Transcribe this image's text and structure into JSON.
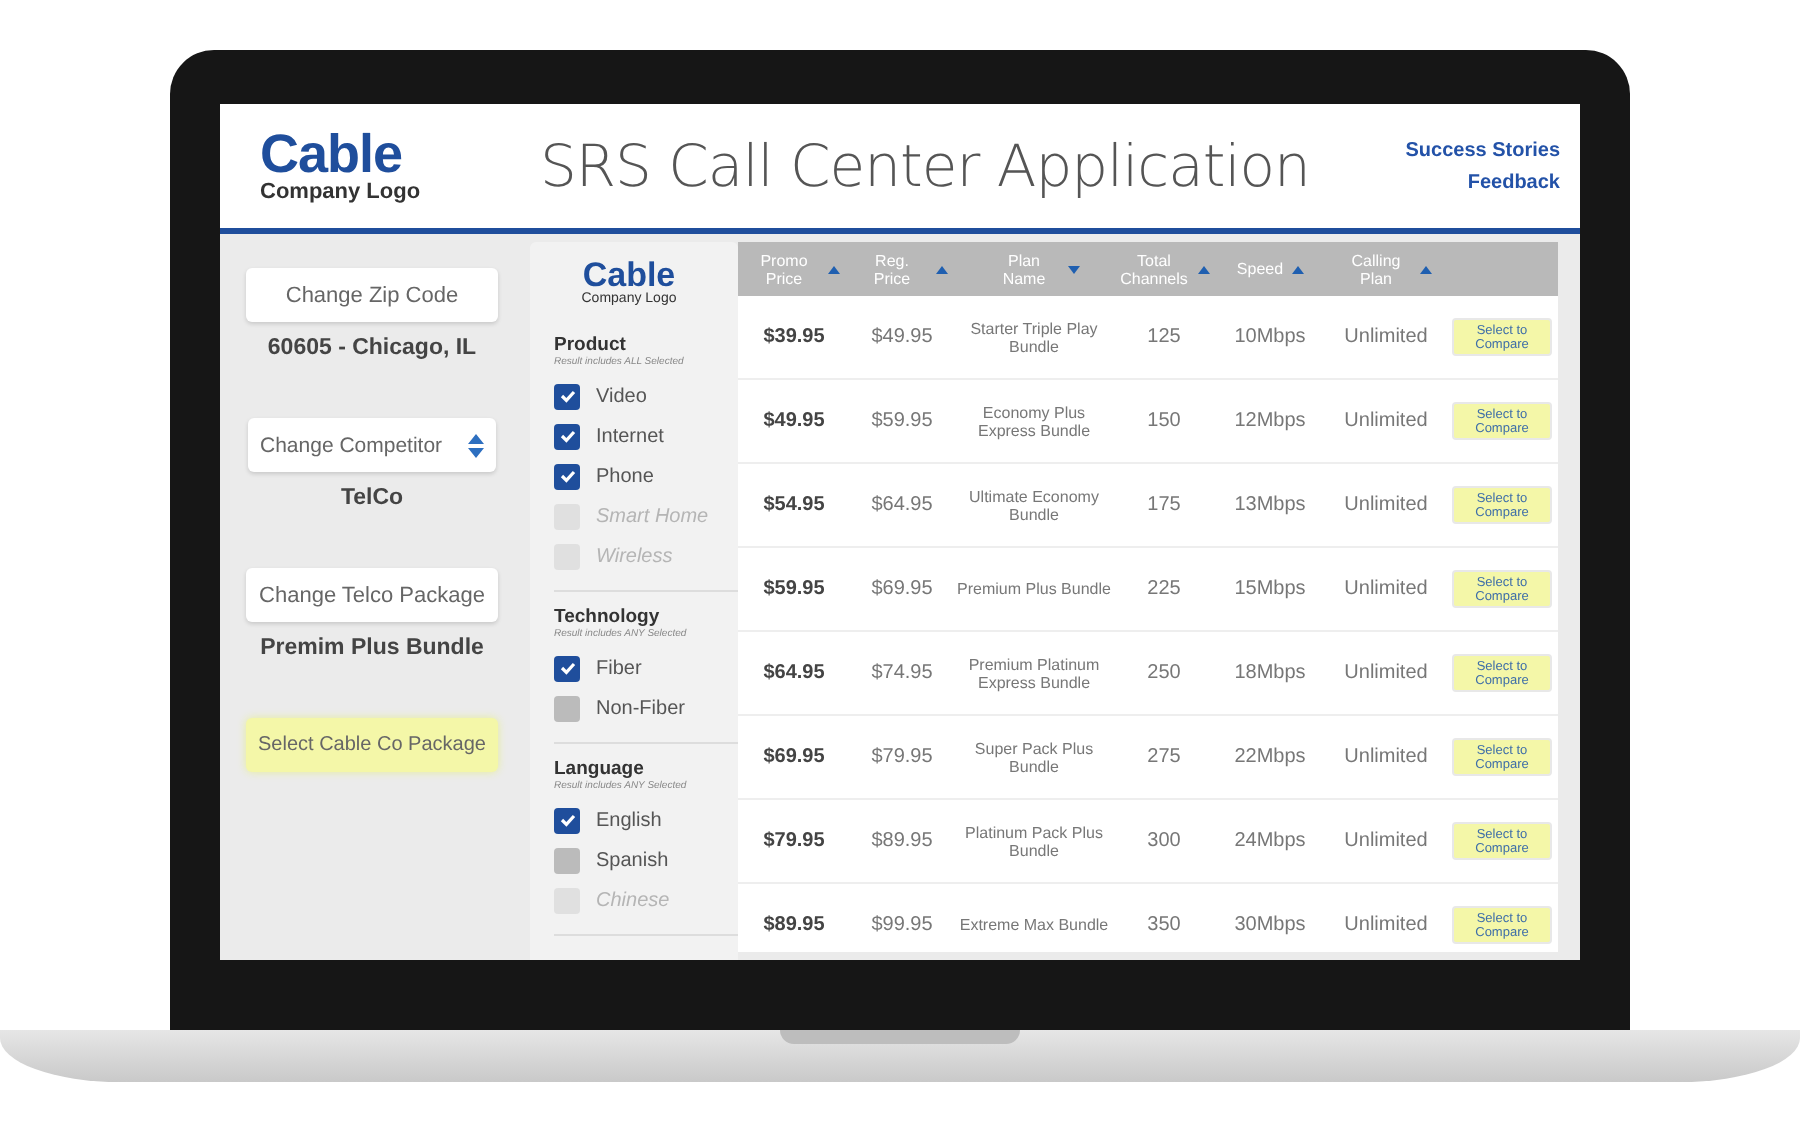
{
  "header": {
    "logo": {
      "name": "Cable",
      "tagline": "Company Logo"
    },
    "title": "SRS Call Center Application",
    "links": [
      "Success Stories",
      "Feedback"
    ]
  },
  "left_panel": [
    {
      "control": {
        "kind": "button",
        "label": "Change Zip Code"
      },
      "value": "60605 - Chicago, IL"
    },
    {
      "control": {
        "kind": "select",
        "label": "Change Competitor"
      },
      "value": "TelCo"
    },
    {
      "control": {
        "kind": "button",
        "label": "Change Telco Package"
      },
      "value": "Premim Plus Bundle"
    },
    {
      "control": {
        "kind": "highlight",
        "label": "Select Cable Co Package"
      }
    }
  ],
  "filters": {
    "logo": {
      "name": "Cable",
      "tagline": "Company Logo"
    },
    "groups": [
      {
        "title": "Product",
        "note": "Result includes ALL Selected",
        "options": [
          {
            "label": "Video",
            "checked": true,
            "disabled": false
          },
          {
            "label": "Internet",
            "checked": true,
            "disabled": false
          },
          {
            "label": "Phone",
            "checked": true,
            "disabled": false
          },
          {
            "label": "Smart Home",
            "checked": false,
            "disabled": true
          },
          {
            "label": "Wireless",
            "checked": false,
            "disabled": true
          }
        ]
      },
      {
        "title": "Technology",
        "note": "Result includes ANY Selected",
        "options": [
          {
            "label": "Fiber",
            "checked": true,
            "disabled": false
          },
          {
            "label": "Non-Fiber",
            "checked": false,
            "disabled": false
          }
        ]
      },
      {
        "title": "Language",
        "note": "Result includes ANY Selected",
        "options": [
          {
            "label": "English",
            "checked": true,
            "disabled": false
          },
          {
            "label": "Spanish",
            "checked": false,
            "disabled": false
          },
          {
            "label": "Chinese",
            "checked": false,
            "disabled": true
          }
        ]
      }
    ]
  },
  "table": {
    "columns": [
      {
        "label": "Promo Price",
        "descending": false
      },
      {
        "label": "Reg. Price",
        "descending": false
      },
      {
        "label": "Plan Name",
        "descending": true
      },
      {
        "label": "Total Channels",
        "descending": false
      },
      {
        "label": "Speed",
        "descending": false
      },
      {
        "label": "Calling Plan",
        "descending": false
      }
    ],
    "rows": [
      {
        "promo": "$39.95",
        "regular": "$49.95",
        "plan": "Starter Triple Play Bundle",
        "channels": "125",
        "speed": "10Mbps",
        "calling": "Unlimited",
        "action": "Select to Compare"
      },
      {
        "promo": "$49.95",
        "regular": "$59.95",
        "plan": "Economy Plus Express Bundle",
        "channels": "150",
        "speed": "12Mbps",
        "calling": "Unlimited",
        "action": "Select to Compare"
      },
      {
        "promo": "$54.95",
        "regular": "$64.95",
        "plan": "Ultimate Economy Bundle",
        "channels": "175",
        "speed": "13Mbps",
        "calling": "Unlimited",
        "action": "Select to Compare"
      },
      {
        "promo": "$59.95",
        "regular": "$69.95",
        "plan": "Premium Plus Bundle",
        "channels": "225",
        "speed": "15Mbps",
        "calling": "Unlimited",
        "action": "Select to Compare"
      },
      {
        "promo": "$64.95",
        "regular": "$74.95",
        "plan": "Premium Platinum Express Bundle",
        "channels": "250",
        "speed": "18Mbps",
        "calling": "Unlimited",
        "action": "Select to Compare"
      },
      {
        "promo": "$69.95",
        "regular": "$79.95",
        "plan": "Super Pack Plus Bundle",
        "channels": "275",
        "speed": "22Mbps",
        "calling": "Unlimited",
        "action": "Select to Compare"
      },
      {
        "promo": "$79.95",
        "regular": "$89.95",
        "plan": "Platinum Pack Plus Bundle",
        "channels": "300",
        "speed": "24Mbps",
        "calling": "Unlimited",
        "action": "Select to Compare"
      },
      {
        "promo": "$89.95",
        "regular": "$99.95",
        "plan": "Extreme Max Bundle",
        "channels": "350",
        "speed": "30Mbps",
        "calling": "Unlimited",
        "action": "Select to Compare"
      }
    ]
  }
}
